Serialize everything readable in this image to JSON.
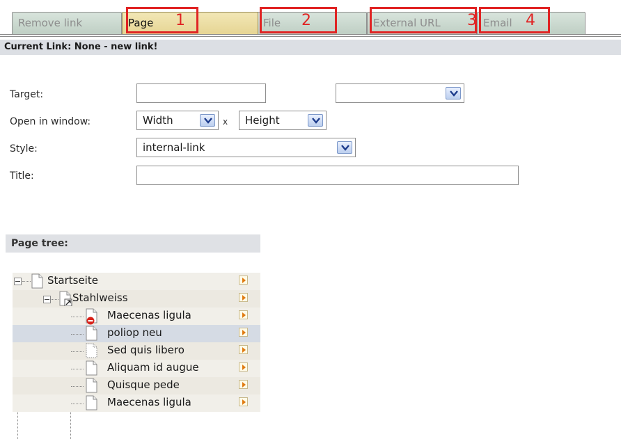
{
  "tabs": [
    {
      "label": "Remove link",
      "active": false
    },
    {
      "label": "Page",
      "active": true
    },
    {
      "label": "File",
      "active": false
    },
    {
      "label": "External URL",
      "active": false
    },
    {
      "label": "Email",
      "active": false
    }
  ],
  "callouts": [
    "1",
    "2",
    "3",
    "4"
  ],
  "current_link": "Current Link: None - new link!",
  "form": {
    "target_label": "Target:",
    "target_value": "",
    "target_select_value": "",
    "open_in_window_label": "Open in window:",
    "width_value": "Width",
    "times": "x",
    "height_value": "Height",
    "style_label": "Style:",
    "style_value": "internal-link",
    "title_label": "Title:",
    "title_value": ""
  },
  "page_tree": {
    "title": "Page tree:",
    "items": [
      {
        "label": "Startseite",
        "icon": "page-icon"
      },
      {
        "label": "Stahlweiss",
        "icon": "shortcut-page-icon"
      },
      {
        "label": "Maecenas ligula",
        "icon": "restricted-page-icon"
      },
      {
        "label": "poliop neu",
        "icon": "page-icon"
      },
      {
        "label": "Sed quis libero",
        "icon": "hidden-page-icon"
      },
      {
        "label": "Aliquam id augue",
        "icon": "page-icon"
      },
      {
        "label": "Quisque pede",
        "icon": "page-icon"
      },
      {
        "label": "Maecenas ligula",
        "icon": "page-icon"
      }
    ]
  },
  "colors": {
    "accent_red": "#e02424",
    "active_tab": "#ecdc9f",
    "inactive_tab": "#cddbd1",
    "arrow_orange": "#e07a10"
  }
}
